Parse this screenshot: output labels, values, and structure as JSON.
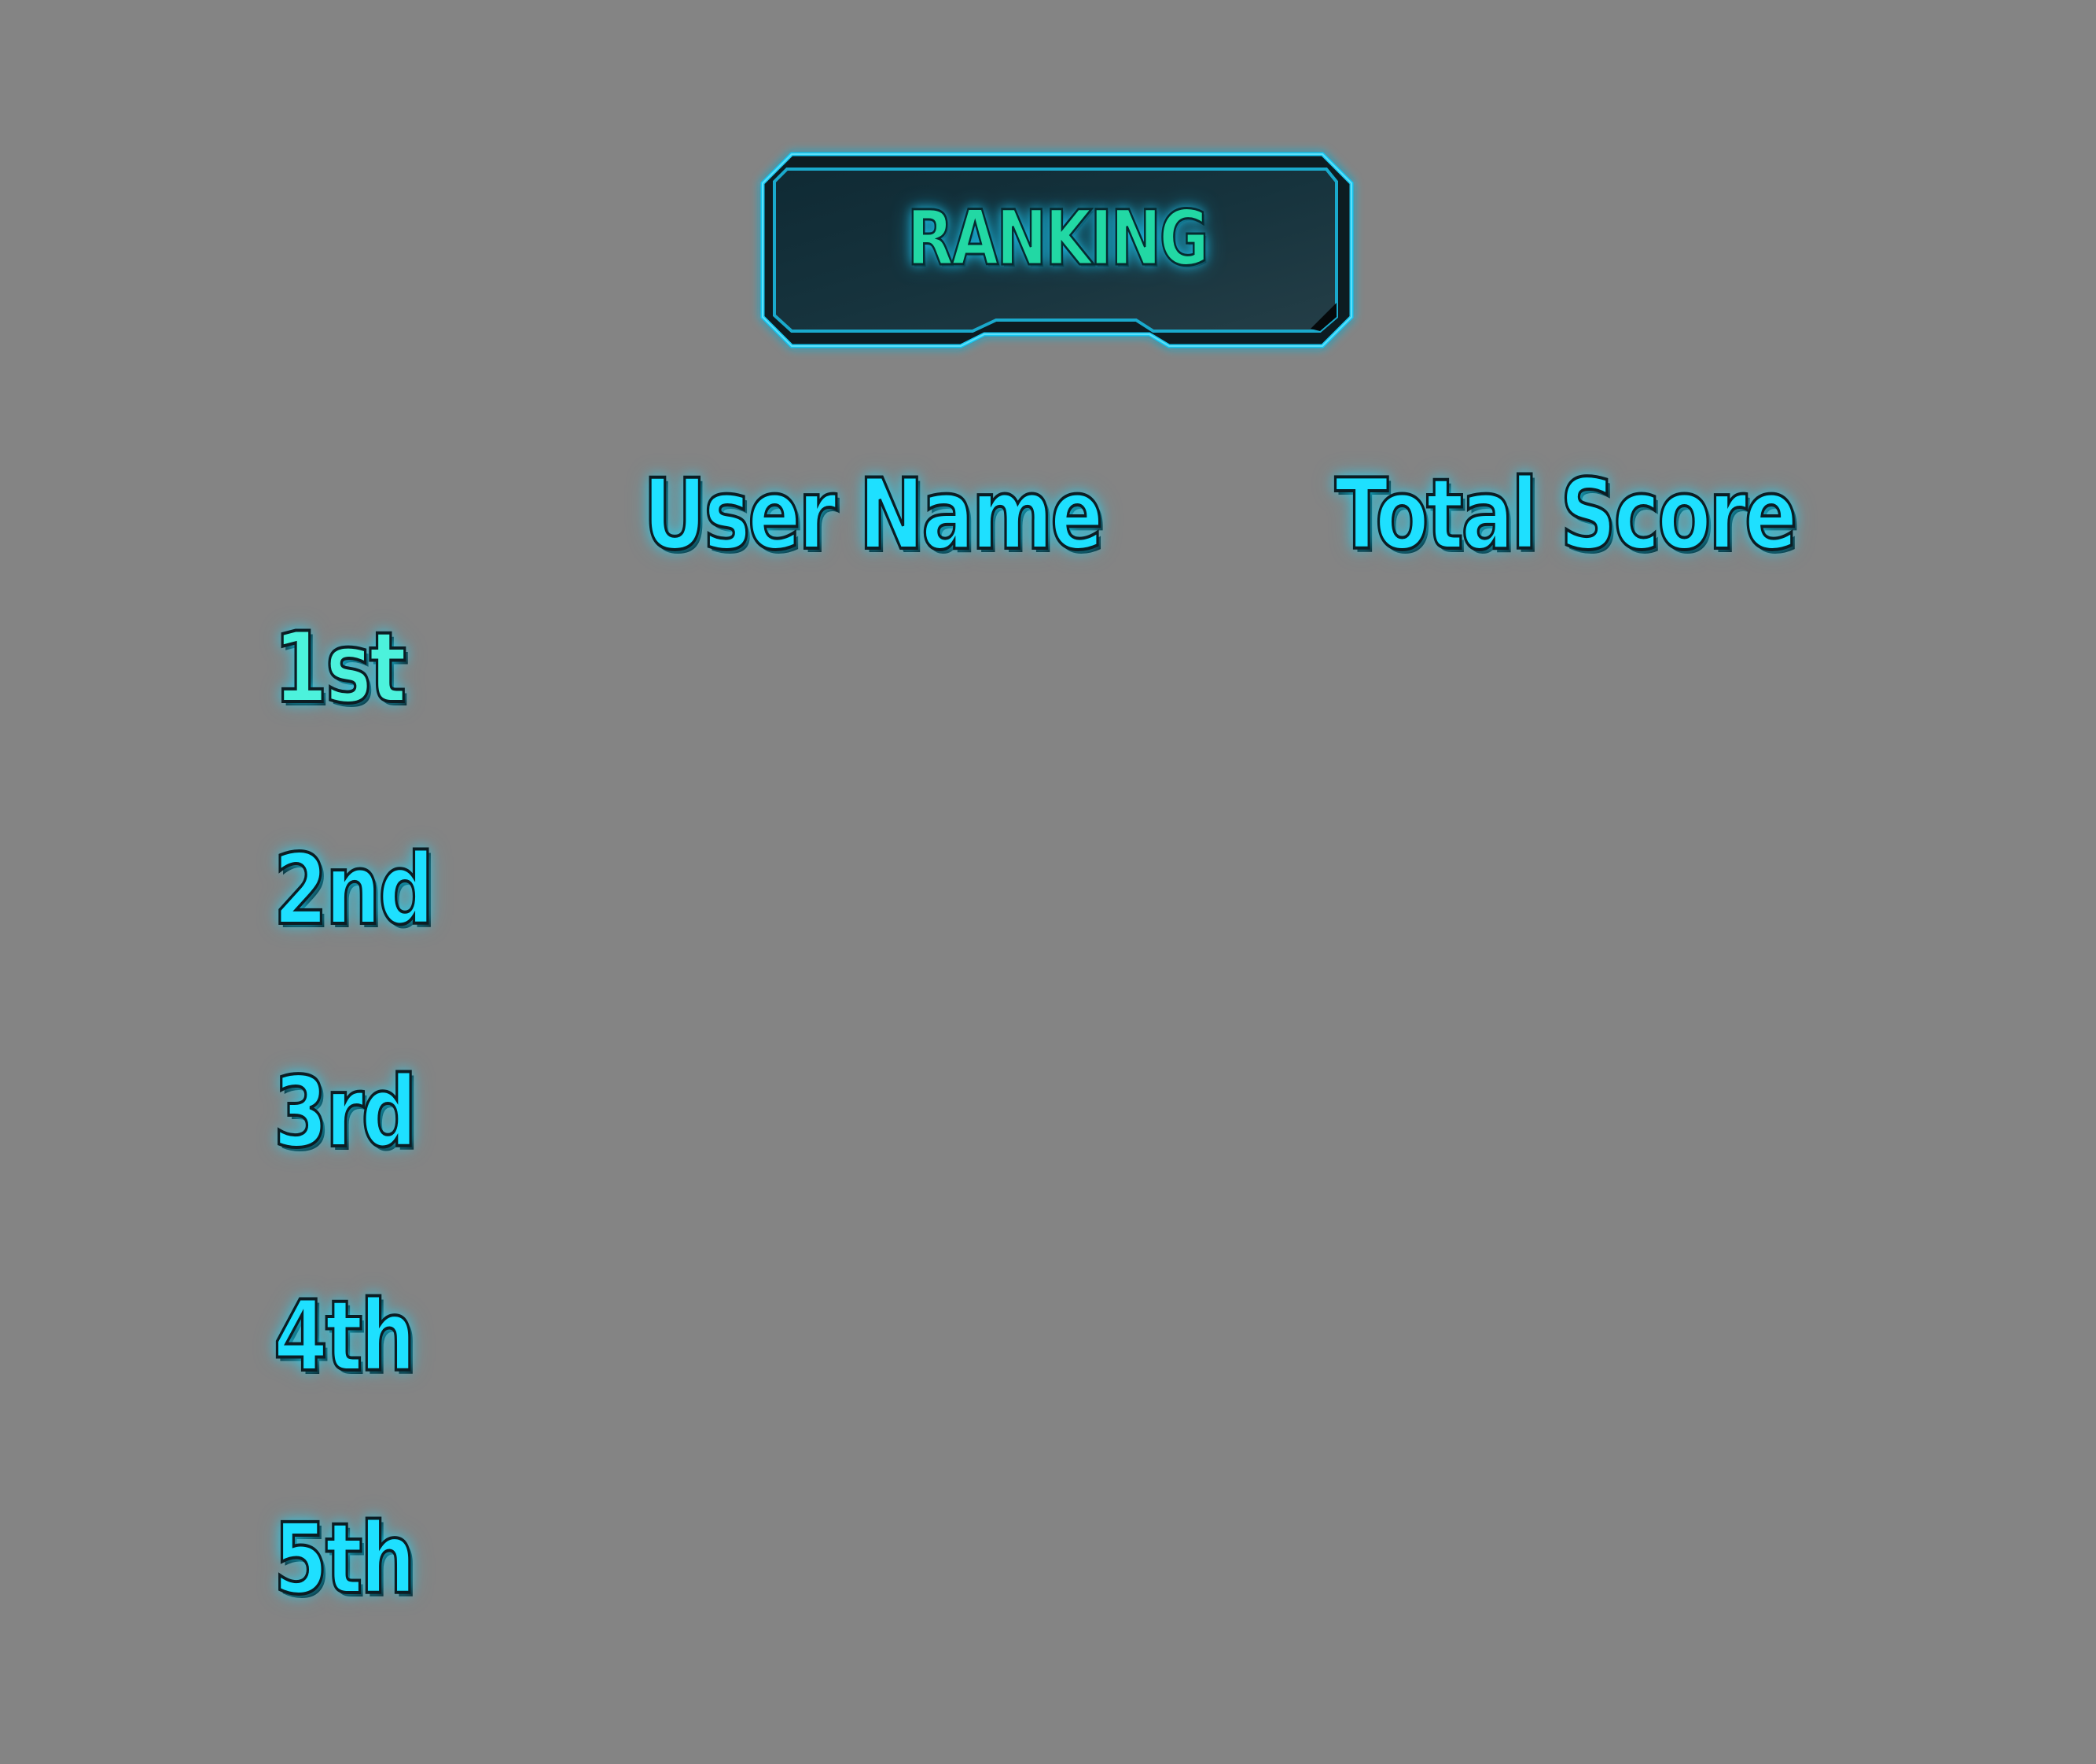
{
  "title": "RANKING",
  "columns": {
    "user_name": "User Name",
    "total_score": "Total Score"
  },
  "rows": [
    {
      "rank": "1st",
      "user": "",
      "score": ""
    },
    {
      "rank": "2nd",
      "user": "",
      "score": ""
    },
    {
      "rank": "3rd",
      "user": "",
      "score": ""
    },
    {
      "rank": "4th",
      "user": "",
      "score": ""
    },
    {
      "rank": "5th",
      "user": "",
      "score": ""
    }
  ],
  "colors": {
    "background": "#848484",
    "accent_cyan": "#1ee0ff",
    "title_green": "#22d8a4",
    "first_place": "#4cf2dc",
    "plate_fill": "#12303a",
    "plate_border": "#19c6f0"
  }
}
